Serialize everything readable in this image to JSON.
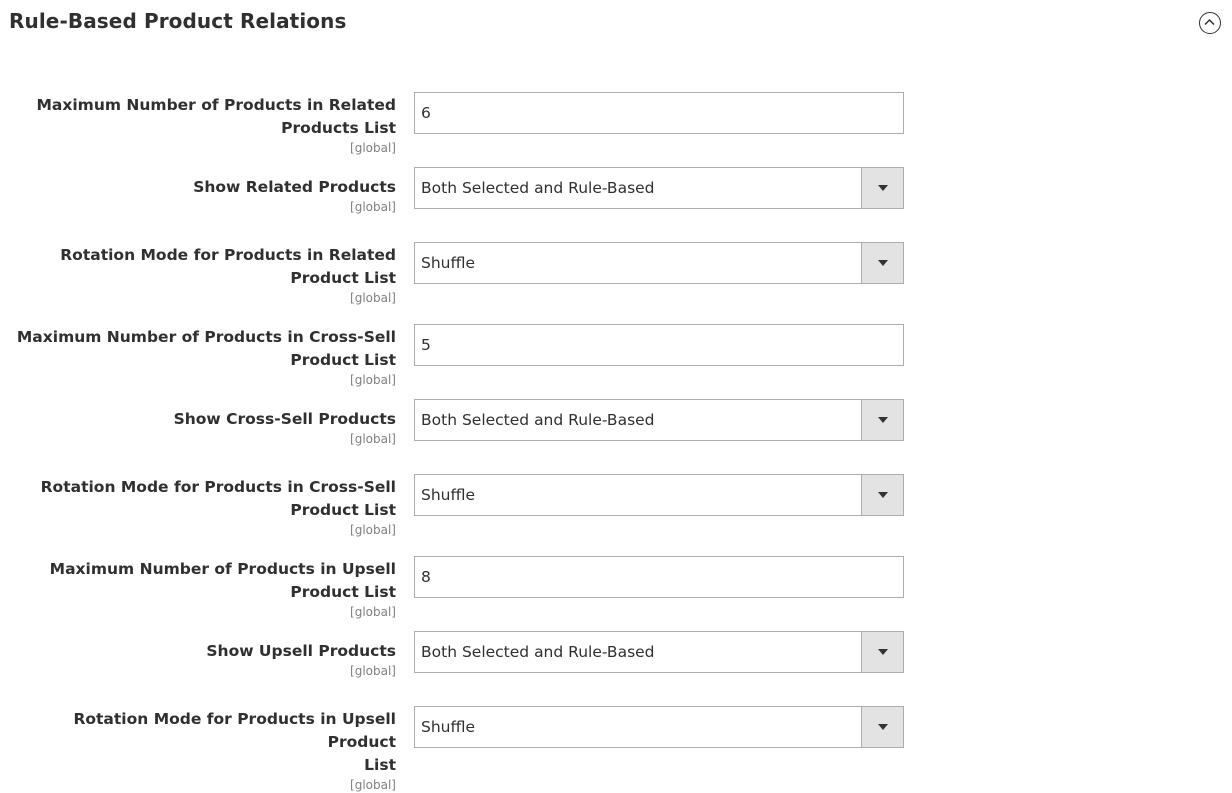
{
  "section": {
    "title": "Rule-Based Product Relations",
    "toggle_icon": "chevron-up-circle-icon"
  },
  "fields": [
    {
      "label_line1": "Maximum Number of Products in Related",
      "label_line2": "Products List",
      "scope": "[global]",
      "type": "input",
      "value": "6"
    },
    {
      "label_line1": "Show Related Products",
      "label_line2": "",
      "scope": "[global]",
      "type": "select",
      "value": "Both Selected and Rule-Based"
    },
    {
      "label_line1": "Rotation Mode for Products in Related",
      "label_line2": "Product List",
      "scope": "[global]",
      "type": "select",
      "value": "Shuffle"
    },
    {
      "label_line1": "Maximum Number of Products in Cross-Sell",
      "label_line2": "Product List",
      "scope": "[global]",
      "type": "input",
      "value": "5"
    },
    {
      "label_line1": "Show Cross-Sell Products",
      "label_line2": "",
      "scope": "[global]",
      "type": "select",
      "value": "Both Selected and Rule-Based"
    },
    {
      "label_line1": "Rotation Mode for Products in Cross-Sell",
      "label_line2": "Product List",
      "scope": "[global]",
      "type": "select",
      "value": "Shuffle"
    },
    {
      "label_line1": "Maximum Number of Products in Upsell",
      "label_line2": "Product List",
      "scope": "[global]",
      "type": "input",
      "value": "8"
    },
    {
      "label_line1": "Show Upsell Products",
      "label_line2": "",
      "scope": "[global]",
      "type": "select",
      "value": "Both Selected and Rule-Based"
    },
    {
      "label_line1": "Rotation Mode for Products in Upsell Product",
      "label_line2": "List",
      "scope": "[global]",
      "type": "select",
      "value": "Shuffle"
    }
  ]
}
